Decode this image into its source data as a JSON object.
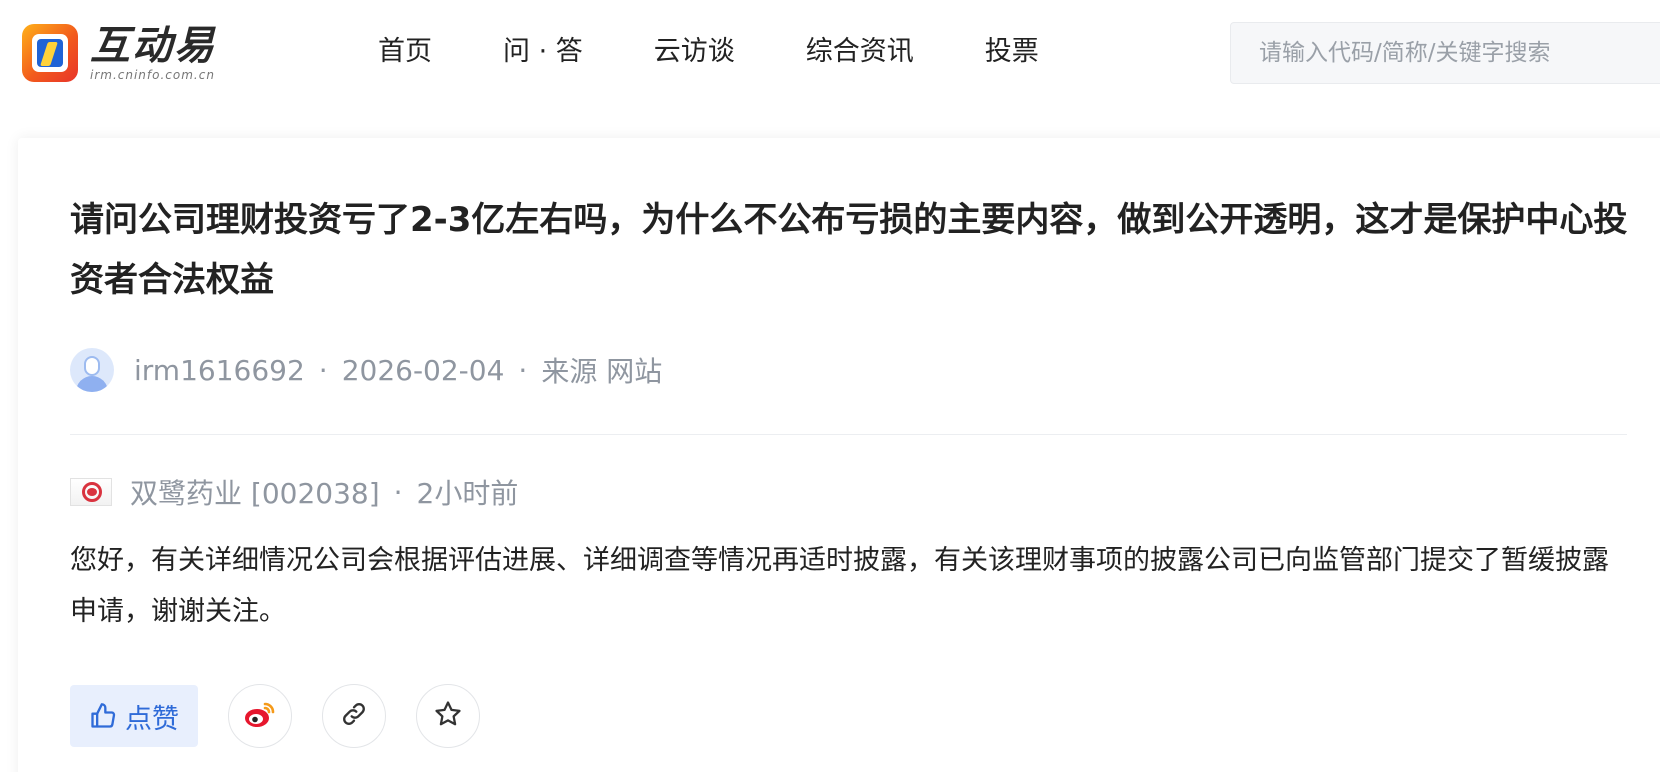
{
  "header": {
    "logo_text": "互动易",
    "logo_url_text": "irm.cninfo.com.cn",
    "nav": [
      {
        "label": "首页"
      },
      {
        "label": "问 · 答"
      },
      {
        "label": "云访谈"
      },
      {
        "label": "综合资讯"
      },
      {
        "label": "投票"
      }
    ],
    "search_placeholder": "请输入代码/简称/关键字搜索"
  },
  "question": {
    "title": "请问公司理财投资亏了2-3亿左右吗，为什么不公布亏损的主要内容，做到公开透明，这才是保护中心投资者合法权益",
    "user": "irm1616692",
    "date": "2026-02-04",
    "source": "来源 网站"
  },
  "answer": {
    "company": "双鹭药业 [002038]",
    "time": "2小时前",
    "text": "您好，有关详细情况公司会根据评估进展、详细调查等情况再适时披露，有关该理财事项的披露公司已向监管部门提交了暂缓披露申请，谢谢关注。"
  },
  "actions": {
    "like_label": "点赞",
    "icons": [
      "thumbs-up-icon",
      "weibo-icon",
      "link-icon",
      "star-icon"
    ]
  },
  "colors": {
    "accent": "#2f6bd8",
    "like_bg": "#e8effd",
    "meta_text": "#8f96a0"
  }
}
